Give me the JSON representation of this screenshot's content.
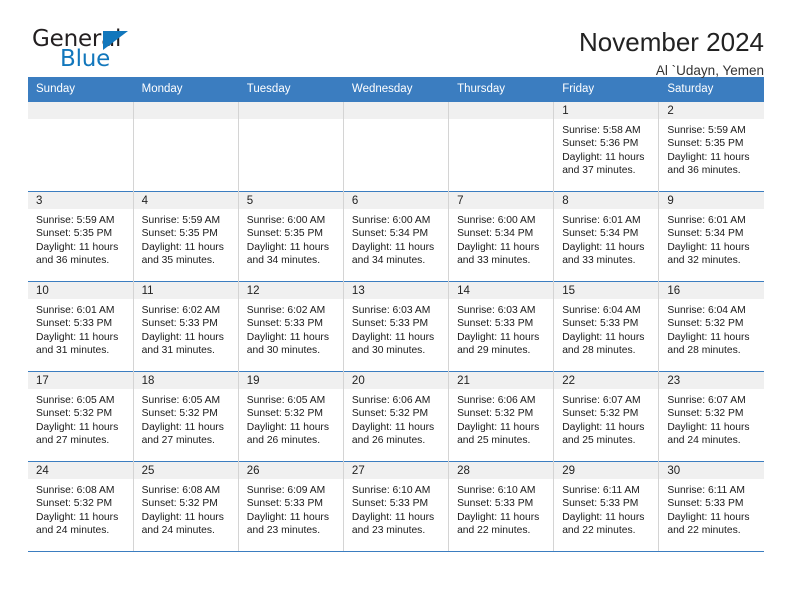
{
  "brand": {
    "name_part1": "General",
    "name_part2": "Blue"
  },
  "header": {
    "title": "November 2024",
    "location": "Al `Udayn, Yemen"
  },
  "theme": {
    "header_blue": "#3b7dc0",
    "logo_blue": "#1277bc",
    "daynum_band": "#f0f0f0",
    "cell_border": "#d4d4d4"
  },
  "weekdays": [
    "Sunday",
    "Monday",
    "Tuesday",
    "Wednesday",
    "Thursday",
    "Friday",
    "Saturday"
  ],
  "labels": {
    "sunrise_prefix": "Sunrise: ",
    "sunset_prefix": "Sunset: ",
    "daylight_prefix": "Daylight: "
  },
  "weeks": [
    [
      {
        "day": "",
        "sunrise": "",
        "sunset": "",
        "daylight": "",
        "empty": true
      },
      {
        "day": "",
        "sunrise": "",
        "sunset": "",
        "daylight": "",
        "empty": true
      },
      {
        "day": "",
        "sunrise": "",
        "sunset": "",
        "daylight": "",
        "empty": true
      },
      {
        "day": "",
        "sunrise": "",
        "sunset": "",
        "daylight": "",
        "empty": true
      },
      {
        "day": "",
        "sunrise": "",
        "sunset": "",
        "daylight": "",
        "empty": true
      },
      {
        "day": "1",
        "sunrise": "Sunrise: 5:58 AM",
        "sunset": "Sunset: 5:36 PM",
        "daylight": "Daylight: 11 hours and 37 minutes."
      },
      {
        "day": "2",
        "sunrise": "Sunrise: 5:59 AM",
        "sunset": "Sunset: 5:35 PM",
        "daylight": "Daylight: 11 hours and 36 minutes."
      }
    ],
    [
      {
        "day": "3",
        "sunrise": "Sunrise: 5:59 AM",
        "sunset": "Sunset: 5:35 PM",
        "daylight": "Daylight: 11 hours and 36 minutes."
      },
      {
        "day": "4",
        "sunrise": "Sunrise: 5:59 AM",
        "sunset": "Sunset: 5:35 PM",
        "daylight": "Daylight: 11 hours and 35 minutes."
      },
      {
        "day": "5",
        "sunrise": "Sunrise: 6:00 AM",
        "sunset": "Sunset: 5:35 PM",
        "daylight": "Daylight: 11 hours and 34 minutes."
      },
      {
        "day": "6",
        "sunrise": "Sunrise: 6:00 AM",
        "sunset": "Sunset: 5:34 PM",
        "daylight": "Daylight: 11 hours and 34 minutes."
      },
      {
        "day": "7",
        "sunrise": "Sunrise: 6:00 AM",
        "sunset": "Sunset: 5:34 PM",
        "daylight": "Daylight: 11 hours and 33 minutes."
      },
      {
        "day": "8",
        "sunrise": "Sunrise: 6:01 AM",
        "sunset": "Sunset: 5:34 PM",
        "daylight": "Daylight: 11 hours and 33 minutes."
      },
      {
        "day": "9",
        "sunrise": "Sunrise: 6:01 AM",
        "sunset": "Sunset: 5:34 PM",
        "daylight": "Daylight: 11 hours and 32 minutes."
      }
    ],
    [
      {
        "day": "10",
        "sunrise": "Sunrise: 6:01 AM",
        "sunset": "Sunset: 5:33 PM",
        "daylight": "Daylight: 11 hours and 31 minutes."
      },
      {
        "day": "11",
        "sunrise": "Sunrise: 6:02 AM",
        "sunset": "Sunset: 5:33 PM",
        "daylight": "Daylight: 11 hours and 31 minutes."
      },
      {
        "day": "12",
        "sunrise": "Sunrise: 6:02 AM",
        "sunset": "Sunset: 5:33 PM",
        "daylight": "Daylight: 11 hours and 30 minutes."
      },
      {
        "day": "13",
        "sunrise": "Sunrise: 6:03 AM",
        "sunset": "Sunset: 5:33 PM",
        "daylight": "Daylight: 11 hours and 30 minutes."
      },
      {
        "day": "14",
        "sunrise": "Sunrise: 6:03 AM",
        "sunset": "Sunset: 5:33 PM",
        "daylight": "Daylight: 11 hours and 29 minutes."
      },
      {
        "day": "15",
        "sunrise": "Sunrise: 6:04 AM",
        "sunset": "Sunset: 5:33 PM",
        "daylight": "Daylight: 11 hours and 28 minutes."
      },
      {
        "day": "16",
        "sunrise": "Sunrise: 6:04 AM",
        "sunset": "Sunset: 5:32 PM",
        "daylight": "Daylight: 11 hours and 28 minutes."
      }
    ],
    [
      {
        "day": "17",
        "sunrise": "Sunrise: 6:05 AM",
        "sunset": "Sunset: 5:32 PM",
        "daylight": "Daylight: 11 hours and 27 minutes."
      },
      {
        "day": "18",
        "sunrise": "Sunrise: 6:05 AM",
        "sunset": "Sunset: 5:32 PM",
        "daylight": "Daylight: 11 hours and 27 minutes."
      },
      {
        "day": "19",
        "sunrise": "Sunrise: 6:05 AM",
        "sunset": "Sunset: 5:32 PM",
        "daylight": "Daylight: 11 hours and 26 minutes."
      },
      {
        "day": "20",
        "sunrise": "Sunrise: 6:06 AM",
        "sunset": "Sunset: 5:32 PM",
        "daylight": "Daylight: 11 hours and 26 minutes."
      },
      {
        "day": "21",
        "sunrise": "Sunrise: 6:06 AM",
        "sunset": "Sunset: 5:32 PM",
        "daylight": "Daylight: 11 hours and 25 minutes."
      },
      {
        "day": "22",
        "sunrise": "Sunrise: 6:07 AM",
        "sunset": "Sunset: 5:32 PM",
        "daylight": "Daylight: 11 hours and 25 minutes."
      },
      {
        "day": "23",
        "sunrise": "Sunrise: 6:07 AM",
        "sunset": "Sunset: 5:32 PM",
        "daylight": "Daylight: 11 hours and 24 minutes."
      }
    ],
    [
      {
        "day": "24",
        "sunrise": "Sunrise: 6:08 AM",
        "sunset": "Sunset: 5:32 PM",
        "daylight": "Daylight: 11 hours and 24 minutes."
      },
      {
        "day": "25",
        "sunrise": "Sunrise: 6:08 AM",
        "sunset": "Sunset: 5:32 PM",
        "daylight": "Daylight: 11 hours and 24 minutes."
      },
      {
        "day": "26",
        "sunrise": "Sunrise: 6:09 AM",
        "sunset": "Sunset: 5:33 PM",
        "daylight": "Daylight: 11 hours and 23 minutes."
      },
      {
        "day": "27",
        "sunrise": "Sunrise: 6:10 AM",
        "sunset": "Sunset: 5:33 PM",
        "daylight": "Daylight: 11 hours and 23 minutes."
      },
      {
        "day": "28",
        "sunrise": "Sunrise: 6:10 AM",
        "sunset": "Sunset: 5:33 PM",
        "daylight": "Daylight: 11 hours and 22 minutes."
      },
      {
        "day": "29",
        "sunrise": "Sunrise: 6:11 AM",
        "sunset": "Sunset: 5:33 PM",
        "daylight": "Daylight: 11 hours and 22 minutes."
      },
      {
        "day": "30",
        "sunrise": "Sunrise: 6:11 AM",
        "sunset": "Sunset: 5:33 PM",
        "daylight": "Daylight: 11 hours and 22 minutes."
      }
    ]
  ]
}
